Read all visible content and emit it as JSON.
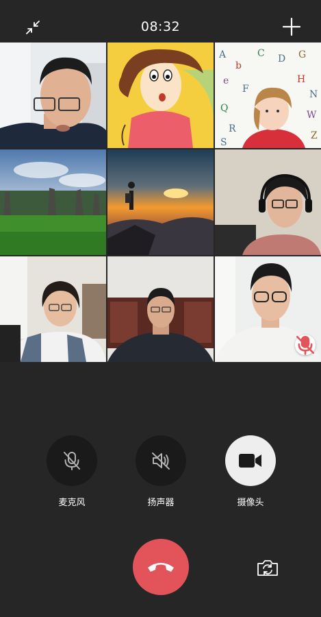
{
  "status": {
    "time": "08:32"
  },
  "icons": {
    "minimize": "minimize-arrows-icon",
    "add": "plus-icon",
    "muted": "mic-muted-icon",
    "microphone": "mic-off-icon",
    "speaker": "speaker-off-icon",
    "camera": "video-camera-icon",
    "hangup": "phone-hangup-icon",
    "switch_camera": "switch-camera-icon"
  },
  "participants": [
    {
      "kind": "camera",
      "muted": false
    },
    {
      "kind": "avatar-cartoon",
      "muted": false
    },
    {
      "kind": "avatar-child-alphabet",
      "muted": false
    },
    {
      "kind": "avatar-landscape",
      "muted": false
    },
    {
      "kind": "avatar-sunset",
      "muted": false
    },
    {
      "kind": "camera",
      "muted": false
    },
    {
      "kind": "camera",
      "muted": false
    },
    {
      "kind": "camera",
      "muted": false
    },
    {
      "kind": "camera",
      "muted": true
    }
  ],
  "controls": {
    "microphone": {
      "label": "麦克风",
      "state": "off"
    },
    "speaker": {
      "label": "扬声器",
      "state": "off"
    },
    "camera": {
      "label": "摄像头",
      "state": "on"
    }
  },
  "colors": {
    "background": "#262626",
    "hangup": "#e2545a",
    "control_off": "#1a1a1a",
    "control_on": "#eeeeee",
    "muted_badge_icon": "#e2545a"
  }
}
